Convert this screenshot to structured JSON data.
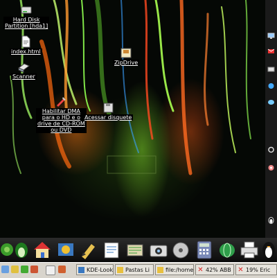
{
  "desktop_icons": [
    {
      "id": "hard-disk",
      "label": "Hard Disk\nPartition [hda1]",
      "icon": "hard-disk-icon"
    },
    {
      "id": "index",
      "label": "index.html",
      "icon": "html-file-icon"
    },
    {
      "id": "scanner",
      "label": "Scanner",
      "icon": "scanner-icon"
    },
    {
      "id": "zipdrive",
      "label": "ZipDrive",
      "icon": "zip-drive-icon"
    },
    {
      "id": "dma",
      "label": "Habilitar DMA\npara o HD e o\ndrive de CD-ROM\nou DVD",
      "icon": "dma-tool-icon"
    },
    {
      "id": "disquete",
      "label": "Acessar disquete",
      "icon": "floppy-icon"
    }
  ],
  "right_bar_icons": [
    "monitor-icon",
    "mail-icon",
    "mail-folder-icon",
    "chat-icon",
    "chat-bubble-icon",
    "power-icon",
    "settings-icon",
    "tux-icon"
  ],
  "panel_launchers": [
    "kde-menu-icon",
    "penguin-icon",
    "home-icon",
    "control-center-icon",
    "graphics-editor-icon",
    "text-editor-icon",
    "office-icon",
    "camera-icon",
    "multimedia-icon",
    "calculator-icon",
    "network-icon",
    "printer-icon",
    "penguin-icon"
  ],
  "taskbar": {
    "tray_icons": [
      "browser-icon",
      "search-icon",
      "ladybug-icon",
      "gear-icon"
    ],
    "buttons": [
      {
        "label": "KDE-Look",
        "icon": "kde-icon"
      },
      {
        "label": "Pastas Li",
        "icon": "folder-icon"
      },
      {
        "label": "file:/home",
        "icon": "folder-icon"
      },
      {
        "label": "42% ABB",
        "icon": "close-icon"
      },
      {
        "label": "19% Eric",
        "icon": "close-icon"
      }
    ]
  },
  "colors": {
    "desktop_bg": "#050805",
    "label_bg": "#000000",
    "label_fg": "#ffffff",
    "panel_bg": "#1a1a1a",
    "taskbar_bg": "#d8d4cc",
    "accent_green": "#7cd83a",
    "accent_orange": "#ff7a1a"
  }
}
